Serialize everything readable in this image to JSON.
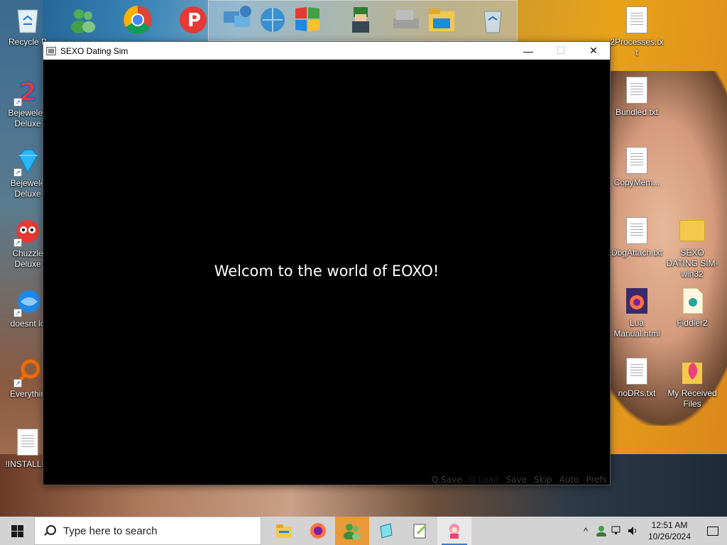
{
  "desktop": {
    "left_icons": [
      {
        "label": "Recycle B",
        "icon": "recycle-bin-icon"
      },
      {
        "label": "Bejeweled Deluxe",
        "icon": "bejeweled2-icon"
      },
      {
        "label": "Bejewele Deluxe",
        "icon": "bejeweled-gem-icon"
      },
      {
        "label": "Chuzzle Deluxe",
        "icon": "chuzzle-icon"
      },
      {
        "label": "doesnt lo",
        "icon": "thunderbird-icon"
      },
      {
        "label": "Everythin",
        "icon": "everything-search-icon"
      },
      {
        "label": "!INSTALLIN",
        "icon": "text-file-icon"
      }
    ],
    "right_icons": [
      {
        "label": "2Processes.txt",
        "icon": "text-file-icon"
      },
      {
        "label": "Bundled.txt",
        "icon": "text-file-icon"
      },
      {
        "label": "CopyMem...",
        "icon": "text-file-icon"
      },
      {
        "label": "DbgAttach.txt",
        "icon": "text-file-icon"
      },
      {
        "label": "SEXO DATING SIM-win32",
        "icon": "folder-icon"
      },
      {
        "label": "Lua Manual.html",
        "icon": "firefox-html-icon"
      },
      {
        "label": "Fiddler2",
        "icon": "fiddler-icon"
      },
      {
        "label": "noDRs.txt",
        "icon": "text-file-icon"
      },
      {
        "label": "My Received Files",
        "icon": "received-files-icon"
      }
    ]
  },
  "window": {
    "title": "SEXO Dating Sim",
    "minimize_symbol": "—",
    "maximize_symbol": "☐",
    "close_symbol": "✕"
  },
  "game": {
    "dialogue": "Welcom to the world of EOXO!",
    "quick_menu": [
      "Q.Save",
      "Q.Load",
      "Save",
      "Skip",
      "Auto",
      "Prefs"
    ]
  },
  "taskbar": {
    "search_placeholder": "Type here to search",
    "apps": [
      "file-explorer-icon",
      "firefox-icon",
      "messenger-icon",
      "notepad-icon",
      "notepad-plus-icon",
      "dating-sim-icon"
    ],
    "tray_chevron": "^",
    "time": "12:51 AM",
    "date": "10/26/2024"
  },
  "colors": {
    "taskbar_bg": "#d3d3d3",
    "window_bg": "#000000",
    "dialogue_text": "#ffffff"
  }
}
